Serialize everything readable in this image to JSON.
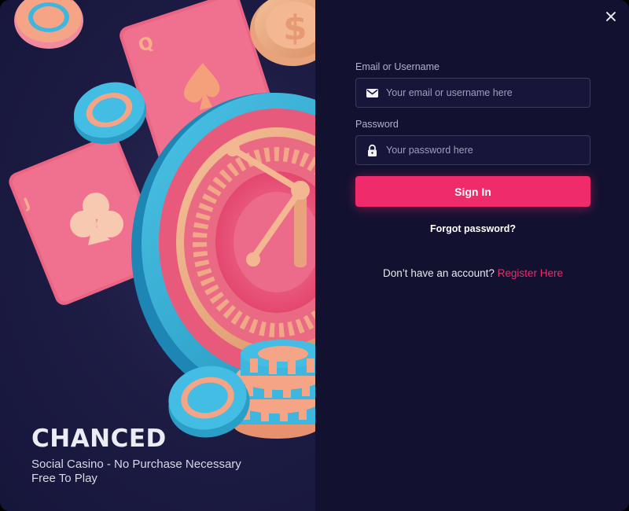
{
  "brand": {
    "name": "CHANCED",
    "tagline_1": "Social Casino - No Purchase Necessary",
    "tagline_2": "Free To Play"
  },
  "dialog": {
    "close_icon": "close-icon"
  },
  "form": {
    "email_label": "Email or Username",
    "email_placeholder": "Your email or username here",
    "email_value": "",
    "email_icon": "mail-icon",
    "password_label": "Password",
    "password_placeholder": "Your password here",
    "password_value": "",
    "password_icon": "lock-icon",
    "submit_label": "Sign In",
    "forgot_label": "Forgot password?",
    "register_prompt": "Don’t have an account?",
    "register_link": "Register Here"
  },
  "colors": {
    "accent": "#ef2b6c",
    "panel_bg": "#121130",
    "hero_bg": "#1d1c44"
  }
}
